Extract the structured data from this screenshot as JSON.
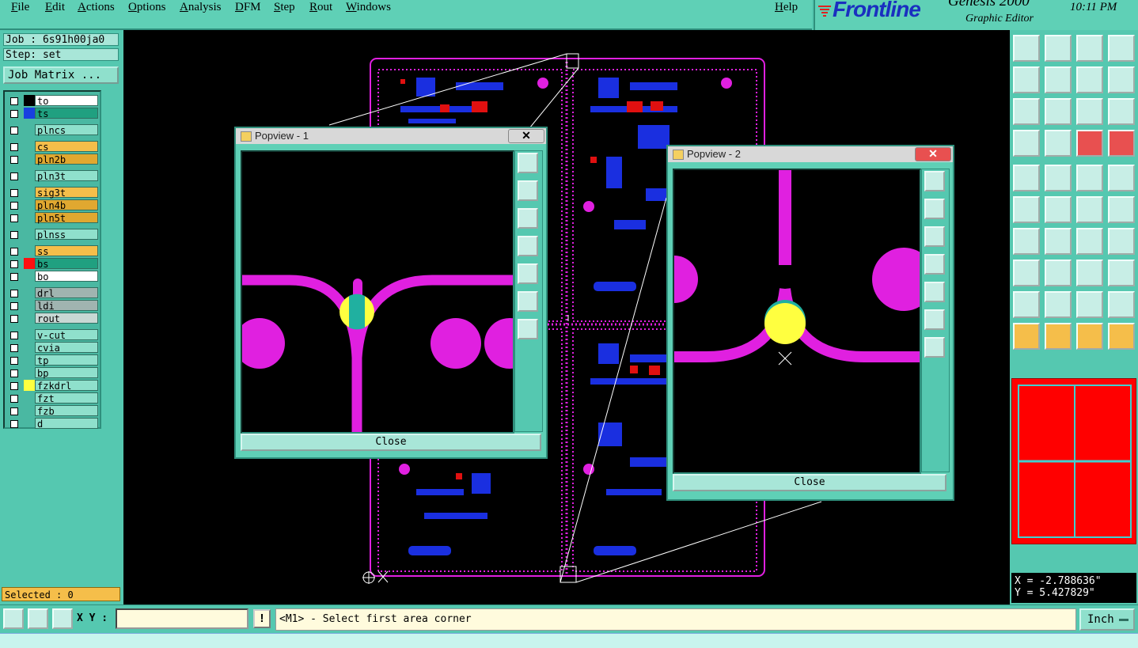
{
  "menu": {
    "items": [
      "File",
      "Edit",
      "Actions",
      "Options",
      "Analysis",
      "DFM",
      "Step",
      "Rout",
      "Windows"
    ],
    "help": "Help"
  },
  "brand": {
    "logo": "Frontline",
    "product": "Genesis 2000",
    "subtitle": "Graphic Editor",
    "time": "10:11 PM"
  },
  "job": {
    "job_label": "Job : 6s91h00ja0",
    "step_label": "Step: set",
    "matrix_button": "Job Matrix ..."
  },
  "layers": [
    {
      "name": "to",
      "color": "#ffffff",
      "swatch": "#000000"
    },
    {
      "name": "ts",
      "color": "#20a080",
      "swatch": "#1840e0"
    },
    {
      "name": "plncs",
      "color": "#8fe0cc",
      "swatch": ""
    },
    {
      "name": "cs",
      "color": "#f5be4a",
      "swatch": ""
    },
    {
      "name": "pln2b",
      "color": "#e0a830",
      "swatch": ""
    },
    {
      "name": "pln3t",
      "color": "#8fe0cc",
      "swatch": ""
    },
    {
      "name": "sig3t",
      "color": "#f5be4a",
      "swatch": ""
    },
    {
      "name": "pln4b",
      "color": "#e0a830",
      "swatch": ""
    },
    {
      "name": "pln5t",
      "color": "#e0a830",
      "swatch": ""
    },
    {
      "name": "plnss",
      "color": "#8fe0cc",
      "swatch": ""
    },
    {
      "name": "ss",
      "color": "#f5be4a",
      "swatch": ""
    },
    {
      "name": "bs",
      "color": "#20a080",
      "swatch": "#ff1010"
    },
    {
      "name": "bo",
      "color": "#ffffff",
      "swatch": ""
    },
    {
      "name": "drl",
      "color": "#a0b4b0",
      "swatch": ""
    },
    {
      "name": "ldi",
      "color": "#a0b4b0",
      "swatch": ""
    },
    {
      "name": "rout",
      "color": "#c8d8d4",
      "swatch": ""
    },
    {
      "name": "v-cut",
      "color": "#8fe0cc",
      "swatch": ""
    },
    {
      "name": "cvia",
      "color": "#8fe0cc",
      "swatch": ""
    },
    {
      "name": "tp",
      "color": "#8fe0cc",
      "swatch": ""
    },
    {
      "name": "bp",
      "color": "#8fe0cc",
      "swatch": ""
    },
    {
      "name": "fzkdrl",
      "color": "#8fe0cc",
      "swatch": "#ffff40"
    },
    {
      "name": "fzt",
      "color": "#8fe0cc",
      "swatch": ""
    },
    {
      "name": "fzb",
      "color": "#8fe0cc",
      "swatch": ""
    },
    {
      "name": "d",
      "color": "#8fe0cc",
      "swatch": ""
    }
  ],
  "selected": "Selected : 0",
  "popview1": {
    "title": "Popview - 1",
    "close_label": "Close"
  },
  "popview2": {
    "title": "Popview - 2",
    "close_label": "Close"
  },
  "coords": {
    "x": "X = -2.788636\"",
    "y": "Y = 5.427829\""
  },
  "bottom": {
    "xy_label": "X Y :",
    "xy_value": "",
    "excl": "!",
    "status": "<M1> - Select first area corner",
    "units": "Inch"
  },
  "colors": {
    "panel": "#55c8b0",
    "canvas": "#000000",
    "trace": "#e020e0",
    "pad_blue": "#1a2fe0",
    "drill_yellow": "#ffff40"
  }
}
